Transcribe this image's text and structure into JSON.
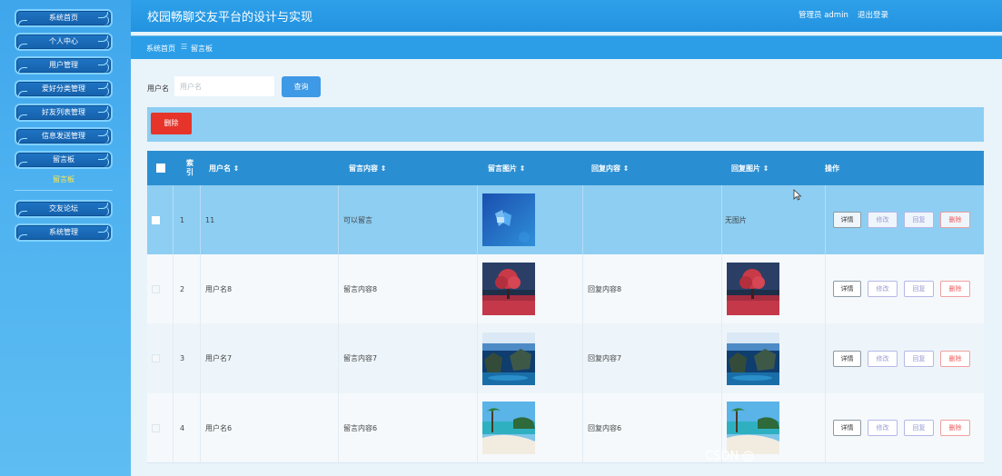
{
  "sidebar": {
    "items": [
      {
        "label": "系统首页"
      },
      {
        "label": "个人中心"
      },
      {
        "label": "用户管理"
      },
      {
        "label": "爱好分类管理"
      },
      {
        "label": "好友列表管理"
      },
      {
        "label": "信息发送管理"
      },
      {
        "label": "留言板"
      },
      {
        "label": "交友论坛"
      },
      {
        "label": "系统管理"
      }
    ],
    "submenu": {
      "label": "留言板"
    }
  },
  "header": {
    "title": "校园畅聊交友平台的设计与实现",
    "user": "管理员 admin",
    "logout": "退出登录"
  },
  "breadcrumb": {
    "home": "系统首页",
    "sep": "☰",
    "current": "留言板"
  },
  "search": {
    "label": "用户名",
    "placeholder": "用户名",
    "button": "查询"
  },
  "actions": {
    "delete": "删除"
  },
  "table": {
    "headers": {
      "index": "索引",
      "username": "用户名 ⇕",
      "content": "留言内容 ⇕",
      "image": "留言图片 ⇕",
      "reply": "回复内容 ⇕",
      "reply_image": "回复图片 ⇕",
      "ops": "操作"
    },
    "rows": [
      {
        "index": "1",
        "username": "11",
        "content": "可以留言",
        "reply": "",
        "reply_image_text": "无图片",
        "image": "abstract-blue-image",
        "reply_image": ""
      },
      {
        "index": "2",
        "username": "用户名8",
        "content": "留言内容8",
        "reply": "回复内容8",
        "reply_image_text": "",
        "image": "red-tree-image",
        "reply_image": "red-tree-image"
      },
      {
        "index": "3",
        "username": "用户名7",
        "content": "留言内容7",
        "reply": "回复内容7",
        "reply_image_text": "",
        "image": "island-sea-image",
        "reply_image": "island-sea-image"
      },
      {
        "index": "4",
        "username": "用户名6",
        "content": "留言内容6",
        "reply": "回复内容6",
        "reply_image_text": "",
        "image": "beach-palm-image",
        "reply_image": "beach-palm-image"
      }
    ],
    "op_labels": {
      "detail": "详情",
      "edit": "修改",
      "reply": "回复",
      "delete": "删除"
    }
  },
  "watermark": "CSDN @"
}
